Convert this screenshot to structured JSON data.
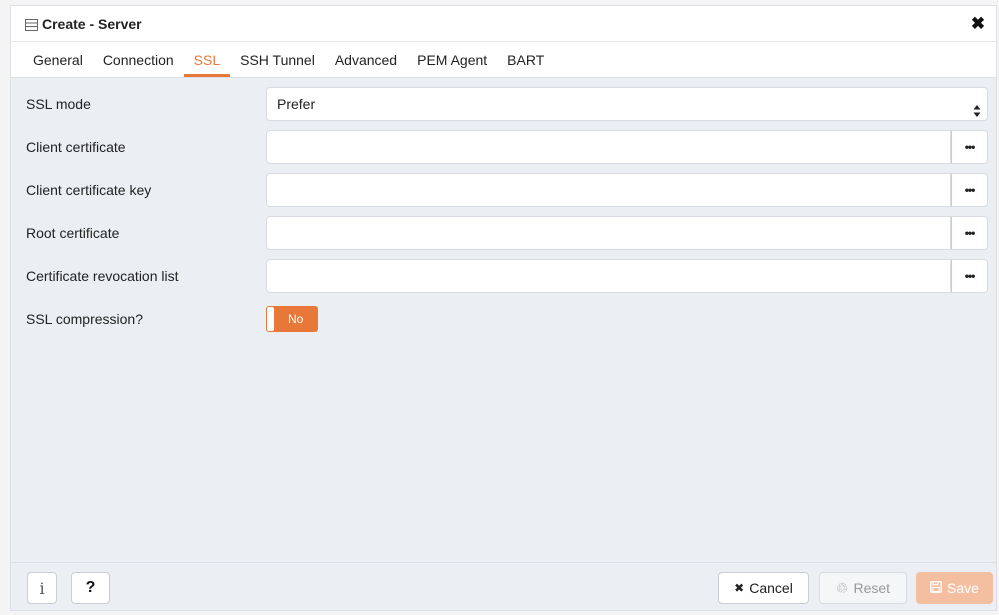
{
  "dialog": {
    "title": "Create - Server",
    "close_symbol": "✖"
  },
  "tabs": [
    {
      "label": "General",
      "active": false
    },
    {
      "label": "Connection",
      "active": false
    },
    {
      "label": "SSL",
      "active": true
    },
    {
      "label": "SSH Tunnel",
      "active": false
    },
    {
      "label": "Advanced",
      "active": false
    },
    {
      "label": "PEM Agent",
      "active": false
    },
    {
      "label": "BART",
      "active": false
    }
  ],
  "form": {
    "ssl_mode": {
      "label": "SSL mode",
      "value": "Prefer"
    },
    "client_certificate": {
      "label": "Client certificate",
      "value": "",
      "browse": "•••"
    },
    "client_certificate_key": {
      "label": "Client certificate key",
      "value": "",
      "browse": "•••"
    },
    "root_certificate": {
      "label": "Root certificate",
      "value": "",
      "browse": "•••"
    },
    "crl": {
      "label": "Certificate revocation list",
      "value": "",
      "browse": "•••"
    },
    "ssl_compression": {
      "label": "SSL compression?",
      "value": "No"
    }
  },
  "footer": {
    "info_label": "i",
    "help_label": "?",
    "cancel_label": "Cancel",
    "cancel_icon": "✖",
    "reset_label": "Reset",
    "reset_icon": "♲",
    "save_label": "Save"
  },
  "colors": {
    "accent": "#e8773a",
    "save_disabled": "#f3bfa0",
    "panel_bg": "#ebeef3"
  },
  "icons": {
    "title": "server-icon",
    "close": "close-icon",
    "browse": "ellipsis-icon",
    "select": "chevron-up-down-icon",
    "cancel": "close-icon",
    "reset": "recycle-icon",
    "save": "save-icon"
  }
}
